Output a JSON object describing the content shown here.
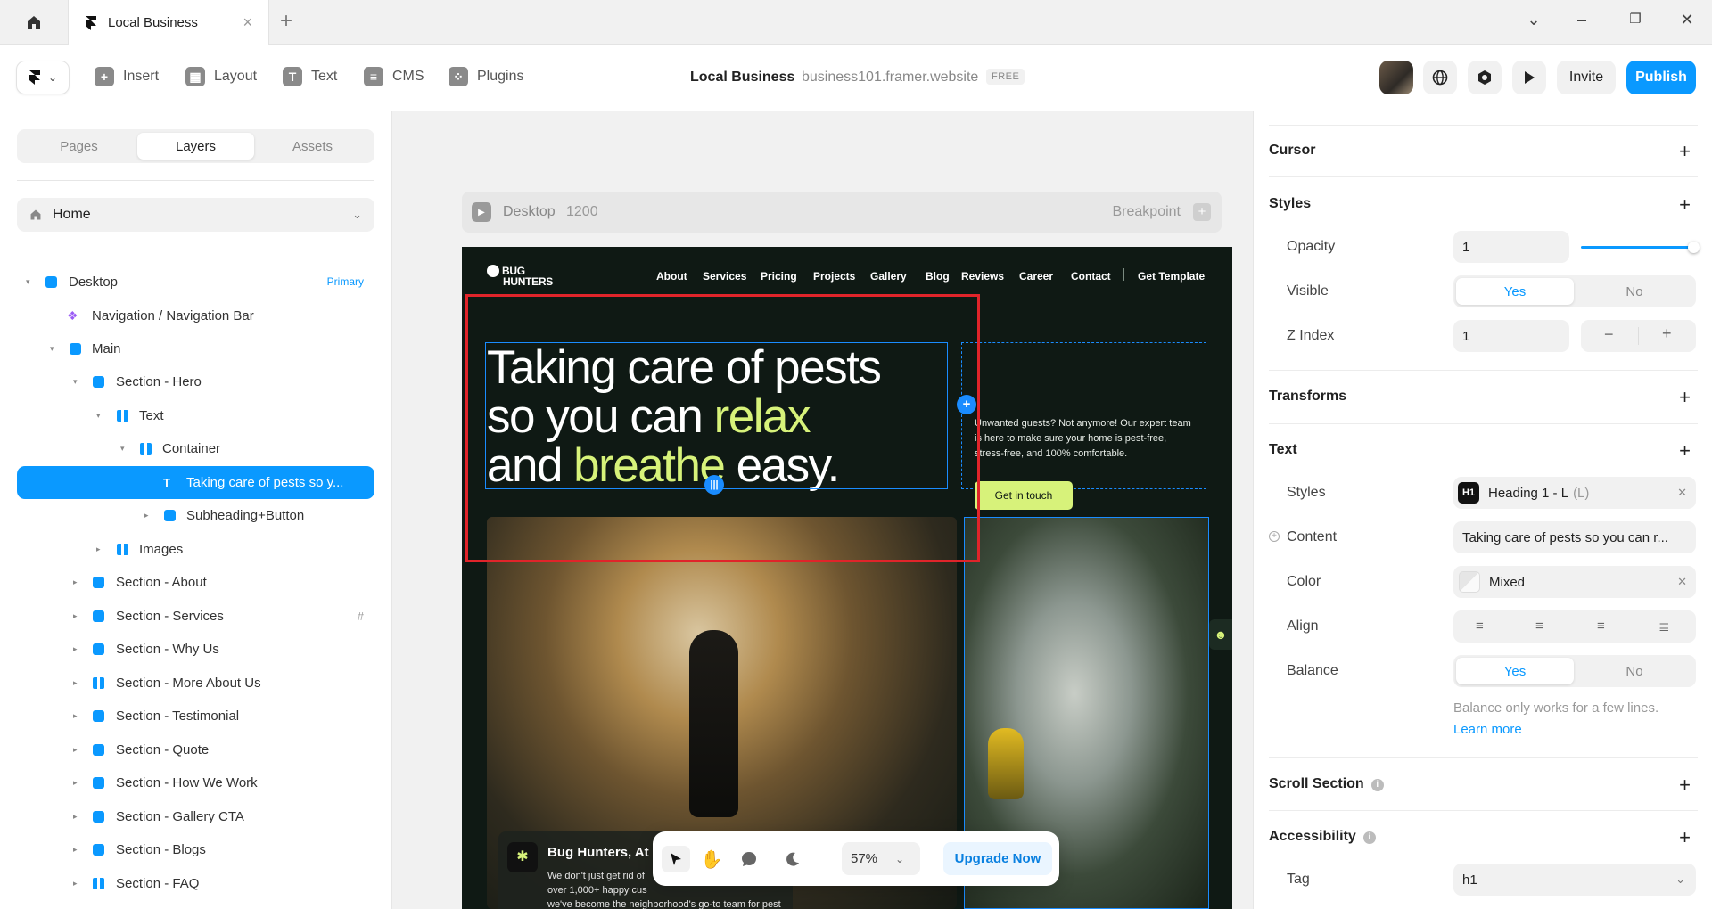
{
  "tabbar": {
    "tab_title": "Local Business",
    "close": "×",
    "new_tab": "+"
  },
  "toolbar": {
    "insert": "Insert",
    "layout": "Layout",
    "text": "Text",
    "cms": "CMS",
    "plugins": "Plugins",
    "project_name": "Local Business",
    "separator": "·",
    "project_url": "business101.framer.website",
    "plan_badge": "FREE",
    "invite": "Invite",
    "publish": "Publish"
  },
  "left_panel": {
    "tabs": [
      "Pages",
      "Layers",
      "Assets"
    ],
    "active_tab": "Layers",
    "page_select": "Home",
    "layers": [
      {
        "label": "Desktop",
        "badge": "Primary"
      },
      {
        "label": "Navigation / Navigation Bar"
      },
      {
        "label": "Main"
      },
      {
        "label": "Section - Hero"
      },
      {
        "label": "Text"
      },
      {
        "label": "Container"
      },
      {
        "label": "Taking care of pests so y..."
      },
      {
        "label": "Subheading+Button"
      },
      {
        "label": "Images"
      },
      {
        "label": "Section - About"
      },
      {
        "label": "Section - Services",
        "badge": "#"
      },
      {
        "label": "Section - Why Us"
      },
      {
        "label": "Section - More About Us"
      },
      {
        "label": "Section - Testimonial"
      },
      {
        "label": "Section - Quote"
      },
      {
        "label": "Section - How We Work"
      },
      {
        "label": "Section - Gallery CTA"
      },
      {
        "label": "Section - Blogs"
      },
      {
        "label": "Section - FAQ"
      }
    ]
  },
  "canvas": {
    "breakpoint_name": "Desktop",
    "breakpoint_width": "1200",
    "breakpoint_label": "Breakpoint",
    "site": {
      "logo_line1": "BUG",
      "logo_line2": "HUNTERS",
      "nav": [
        "About",
        "Services",
        "Pricing",
        "Projects",
        "Gallery",
        "Blog",
        "Reviews",
        "Career",
        "Contact",
        "Get Template"
      ],
      "headline_1": "Taking care of pests",
      "headline_2a": "so you can ",
      "headline_2b": "relax",
      "headline_3a": "and ",
      "headline_3b": "breathe",
      "headline_3c": " easy.",
      "subtext": "Unwanted guests? Not anymore! Our expert team is here to make sure your home is pest-free, stress-free, and 100% comfortable.",
      "cta": "Get in touch",
      "card_title": "Bug Hunters, At",
      "card_body_1": "We don't just get rid of",
      "card_body_2": "over 1,000+ happy cus",
      "card_body_3": "we've become the neighborhood's go-to team for pest control."
    },
    "zoom": "57%",
    "upgrade": "Upgrade Now"
  },
  "right_panel": {
    "cursor": "Cursor",
    "styles": "Styles",
    "opacity_label": "Opacity",
    "opacity_value": "1",
    "opacity_slider_level": 1.0,
    "visible_label": "Visible",
    "yes": "Yes",
    "no": "No",
    "zindex_label": "Z Index",
    "zindex_value": "1",
    "transforms": "Transforms",
    "text": "Text",
    "text_styles_label": "Styles",
    "text_style_badge": "H1",
    "text_style_value": "Heading 1 - L",
    "text_style_size": "(L)",
    "content_label": "Content",
    "content_value": "Taking care of pests so you can r...",
    "color_label": "Color",
    "color_value": "Mixed",
    "align_label": "Align",
    "balance_label": "Balance",
    "balance_note": "Balance only works for a few lines.",
    "learn_more": "Learn more",
    "scroll_section": "Scroll Section",
    "accessibility": "Accessibility",
    "tag_label": "Tag",
    "tag_value": "h1"
  },
  "colors": {
    "accent": "#0a99ff",
    "site_bg": "#0f1914",
    "site_highlight": "#d7f27a",
    "annotation_red": "#e0242a"
  }
}
